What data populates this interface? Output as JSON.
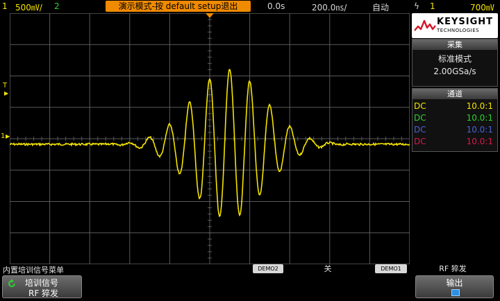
{
  "topbar": {
    "ch1_label": "1",
    "ch1_scale": "500㎷/",
    "ch2_label": "2",
    "demo_banner": "演示模式-按 default setup退出",
    "time_delay": "0.0s",
    "time_scale": "200.0㎱/",
    "trigger_mode": "自动",
    "trigger_icon": "ϟ",
    "trigger_ch": "1",
    "trigger_level": "700㎷"
  },
  "screen": {
    "trigger_marker": "T",
    "ch1_marker": "1",
    "colors": {
      "trace": "#f5e400",
      "grid": "#5a5a5a",
      "trigger": "#f08a00"
    }
  },
  "logo": {
    "brand": "KEYSIGHT",
    "sub": "TECHNOLOGIES"
  },
  "acq": {
    "header": "采集",
    "mode": "标准模式",
    "rate": "2.00GSa/s"
  },
  "channels": {
    "header": "通道",
    "rows": [
      {
        "coupling": "DC",
        "ratio": "10.0:1",
        "color": "#f5e400"
      },
      {
        "coupling": "DC",
        "ratio": "10.0:1",
        "color": "#2ed12e"
      },
      {
        "coupling": "DC",
        "ratio": "10.0:1",
        "color": "#4a60d8"
      },
      {
        "coupling": "DC",
        "ratio": "10.0:1",
        "color": "#d8184a"
      }
    ]
  },
  "menu": {
    "title": "内置培训信号菜单",
    "demo2_tag": "DEMO2",
    "demo2_value": "关",
    "demo1_tag": "DEMO1",
    "demo1_value": "RF 猝发",
    "key1_line1": "培训信号",
    "key1_line2": "RF 猝发",
    "key4_label": "输出"
  }
}
